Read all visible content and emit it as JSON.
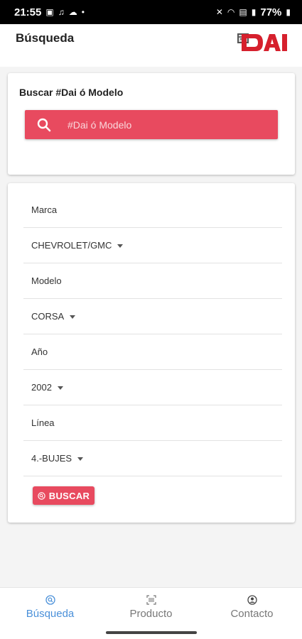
{
  "status_bar": {
    "time": "21:55",
    "battery": "77%",
    "left_icons": [
      "image-icon",
      "headphones-icon",
      "cloud-icon",
      "dot-icon"
    ],
    "right_icons": [
      "mute-icon",
      "wifi-icon",
      "lte-icon",
      "signal-icon",
      "battery-icon"
    ]
  },
  "appbar": {
    "title": "Búsqueda",
    "logo_text": "DAI"
  },
  "search_card": {
    "title": "Buscar #Dai ó Modelo",
    "placeholder": "#Dai ó Modelo",
    "value": ""
  },
  "filters": {
    "marca_label": "Marca",
    "marca_value": "CHEVROLET/GMC",
    "modelo_label": "Modelo",
    "modelo_value": "CORSA",
    "anio_label": "Año",
    "anio_value": "2002",
    "linea_label": "Línea",
    "linea_value": "4.-BUJES",
    "buscar_label": "BUSCAR"
  },
  "bottom_nav": {
    "tabs": [
      {
        "label": "Búsqueda",
        "icon": "search-circle-icon",
        "active": true
      },
      {
        "label": "Producto",
        "icon": "barcode-scan-icon",
        "active": false
      },
      {
        "label": "Contacto",
        "icon": "person-circle-icon",
        "active": false
      }
    ]
  },
  "colors": {
    "accent": "#e84a5f",
    "active_tab": "#4a90d9",
    "background": "#f4f4f4"
  }
}
